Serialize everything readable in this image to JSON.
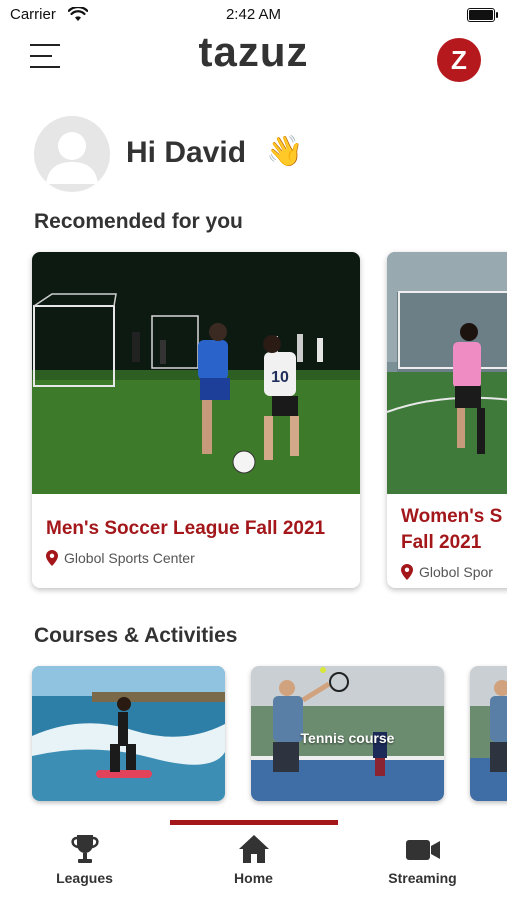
{
  "status_bar": {
    "carrier": "Carrier",
    "time": "2:42 AM"
  },
  "header": {
    "brand": "tazuz",
    "logo_letter": "Z"
  },
  "greeting": {
    "text": "Hi David",
    "emoji": "👋"
  },
  "recommended": {
    "title": "Recomended for you",
    "cards": [
      {
        "title": "Men's Soccer League Fall 2021",
        "location": "Globol Sports Center"
      },
      {
        "title_line1": "Women's S",
        "title_line2": "Fall 2021",
        "location": "Globol Spor"
      }
    ]
  },
  "courses": {
    "title": "Courses & Activities",
    "items": [
      {
        "label": ""
      },
      {
        "label": "Tennis course"
      },
      {
        "label": ""
      }
    ]
  },
  "bottom_nav": {
    "items": [
      {
        "label": "Leagues",
        "icon": "trophy-icon"
      },
      {
        "label": "Home",
        "icon": "home-icon",
        "active": true
      },
      {
        "label": "Streaming",
        "icon": "video-icon"
      }
    ]
  },
  "colors": {
    "accent": "#a3171b",
    "logo": "#b5191e",
    "text": "#333333"
  }
}
